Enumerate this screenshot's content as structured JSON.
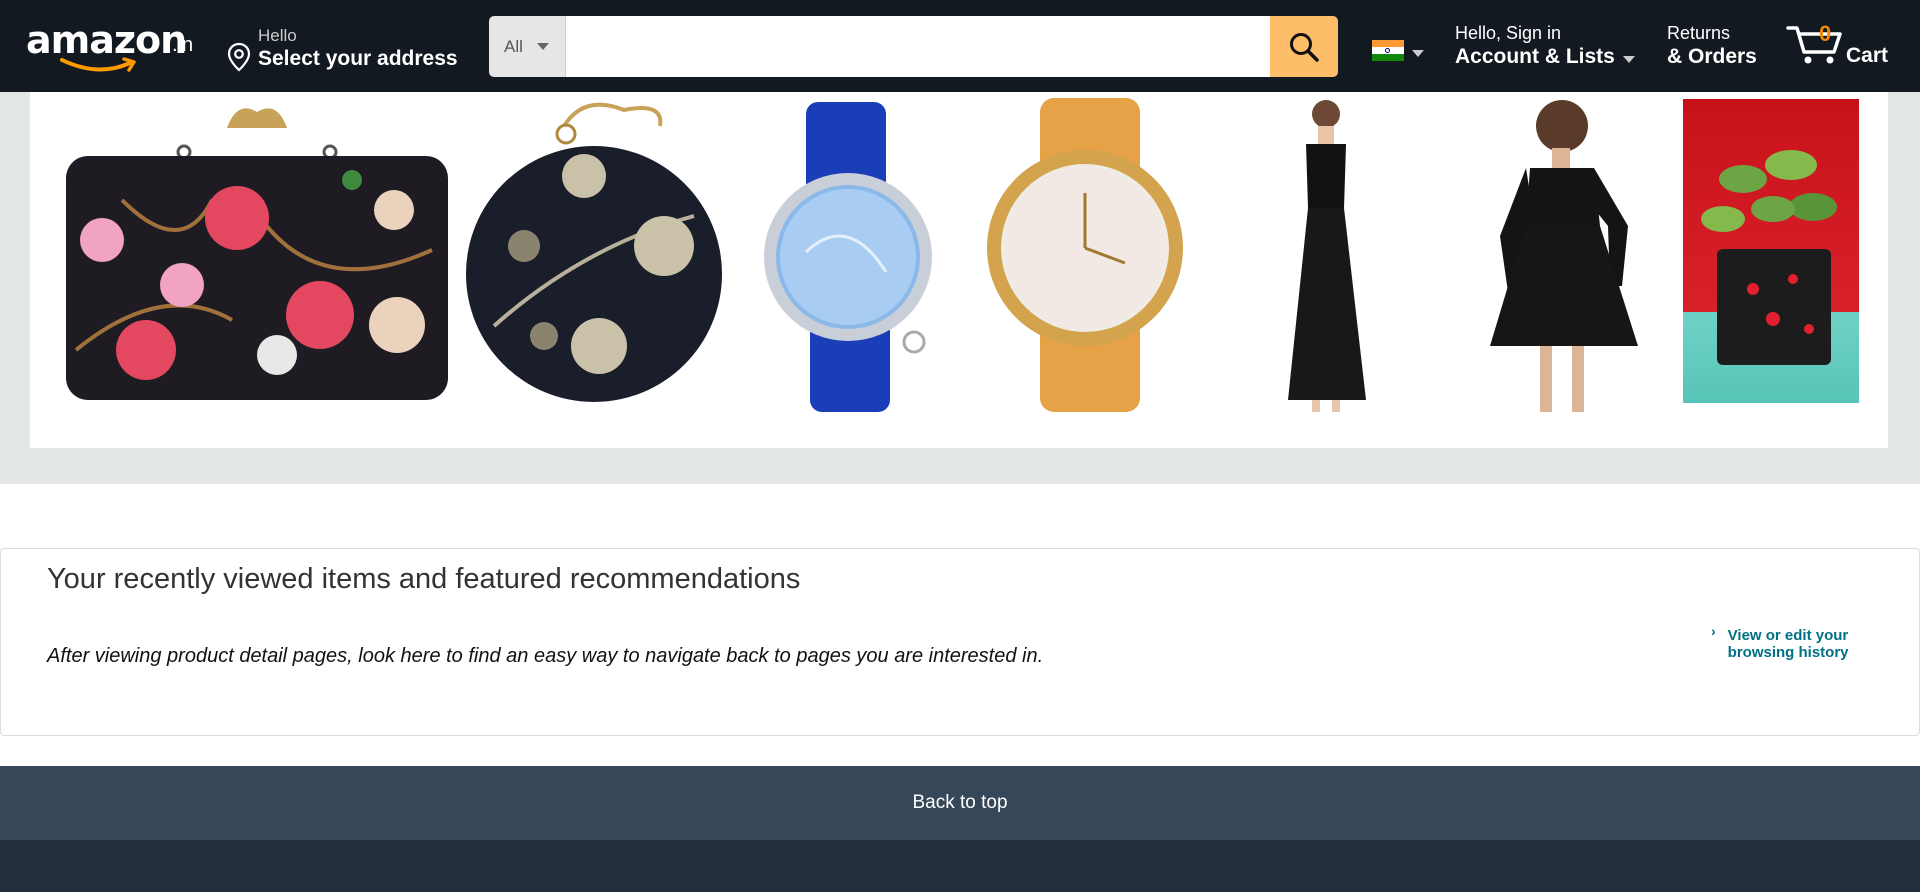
{
  "header": {
    "logo_text": "amazon",
    "logo_suffix": ".in",
    "address_greeting": "Hello",
    "address_action": "Select your address",
    "search": {
      "category": "All",
      "placeholder": "",
      "value": ""
    },
    "language_flag": "india-flag-icon",
    "account_greeting": "Hello, Sign in",
    "account_label": "Account & Lists",
    "returns_line1": "Returns",
    "returns_line2": "& Orders",
    "cart_count": "0",
    "cart_label": "Cart"
  },
  "products": [
    {
      "name": "embroidered-floral-clutch"
    },
    {
      "name": "round-embroidered-clutch"
    },
    {
      "name": "blue-strap-watch"
    },
    {
      "name": "gold-mesh-watch"
    },
    {
      "name": "black-maxi-dress"
    },
    {
      "name": "black-skater-dress"
    },
    {
      "name": "money-plant-pot"
    }
  ],
  "recently_viewed": {
    "title": "Your recently viewed items and featured recommendations",
    "description": "After viewing product detail pages, look here to find an easy way to navigate back to pages you are interested in.",
    "history_link": "View or edit your browsing history"
  },
  "footer": {
    "back_to_top": "Back to top"
  },
  "colors": {
    "nav_bg": "#131921",
    "search_button": "#febd69",
    "cart_count": "#f08804",
    "link": "#007185",
    "back_to_top_bg": "#37475a",
    "footer_bg": "#232f3e"
  }
}
